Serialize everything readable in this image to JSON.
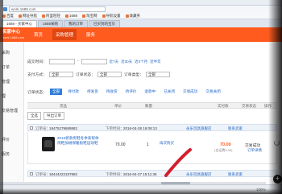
{
  "browser": {
    "url": "work.1688.com",
    "bookmarks": [
      "百度",
      "网址导航",
      "阿里旺旺",
      "1688",
      "淘宝网",
      "导航设置",
      "收藏夹"
    ],
    "tabs": [
      "1688 - 买家中心",
      "1688采购",
      "我的订单",
      "已买到的宝贝"
    ],
    "active_tab": 0
  },
  "site": {
    "logo": "买家中心",
    "logo_url": "work.1688.com",
    "nav": [
      "首页",
      "采购管理",
      "服务"
    ],
    "active_nav": 1
  },
  "sidebar": {
    "items": [
      "采购",
      "订单",
      "管理",
      "理",
      "交易管理",
      "评价",
      "服务"
    ]
  },
  "filters": {
    "date_label": "成交时间：",
    "date_placeholder": "",
    "date_links": [
      "近7天",
      "近30天",
      "近3个月",
      "近半年"
    ],
    "payment_label": "支付方式：",
    "payment_value": "全部",
    "status_label": "订单状态：",
    "status_value": "全部",
    "order_type_label": "订单类型：",
    "order_type_value": "全部"
  },
  "status_tabs": {
    "label": "订单状态：",
    "items": [
      "全部",
      "待付款",
      "待发货",
      "待收货",
      "待评价",
      "退款中",
      "已关闭",
      "交易成功",
      "交易关闭"
    ],
    "active": 0
  },
  "columns": [
    "货品",
    "单价",
    "数量",
    "实付款",
    "交易状态",
    "操作"
  ],
  "toolbar": {
    "select_all": "全选",
    "export": "导出订单"
  },
  "orders": [
    {
      "order_no_label": "订单号：",
      "order_no": "18475279699882",
      "time_label": "下单时间：",
      "time": "2016-04-28 16:08:13",
      "seller": "永乐玩具旗舰店",
      "contact": "联系卖家",
      "product": "2016新款男鞋冬季高帮休闲鞋加绒保暖板鞋运动鞋",
      "price": "70.00",
      "qty": "1",
      "actions": "再次购买",
      "total": "70.00",
      "shipping": "(含运费0.00)",
      "status": "交易成功",
      "detail": "订单详情"
    },
    {
      "order_no_label": "订单号：",
      "order_no": "18444222197882",
      "time_label": "下单时间：",
      "time": "2016-04-27 15:11:36",
      "seller": "永乐玩具旗舰店",
      "contact": "联系卖家"
    }
  ],
  "statusbar": {
    "left": "",
    "zoom": "100%"
  },
  "colors": {
    "brand": "#ff5b1f",
    "link": "#2468c8",
    "tab_active": "#2f7fd8",
    "pen": "#d41d2b"
  }
}
